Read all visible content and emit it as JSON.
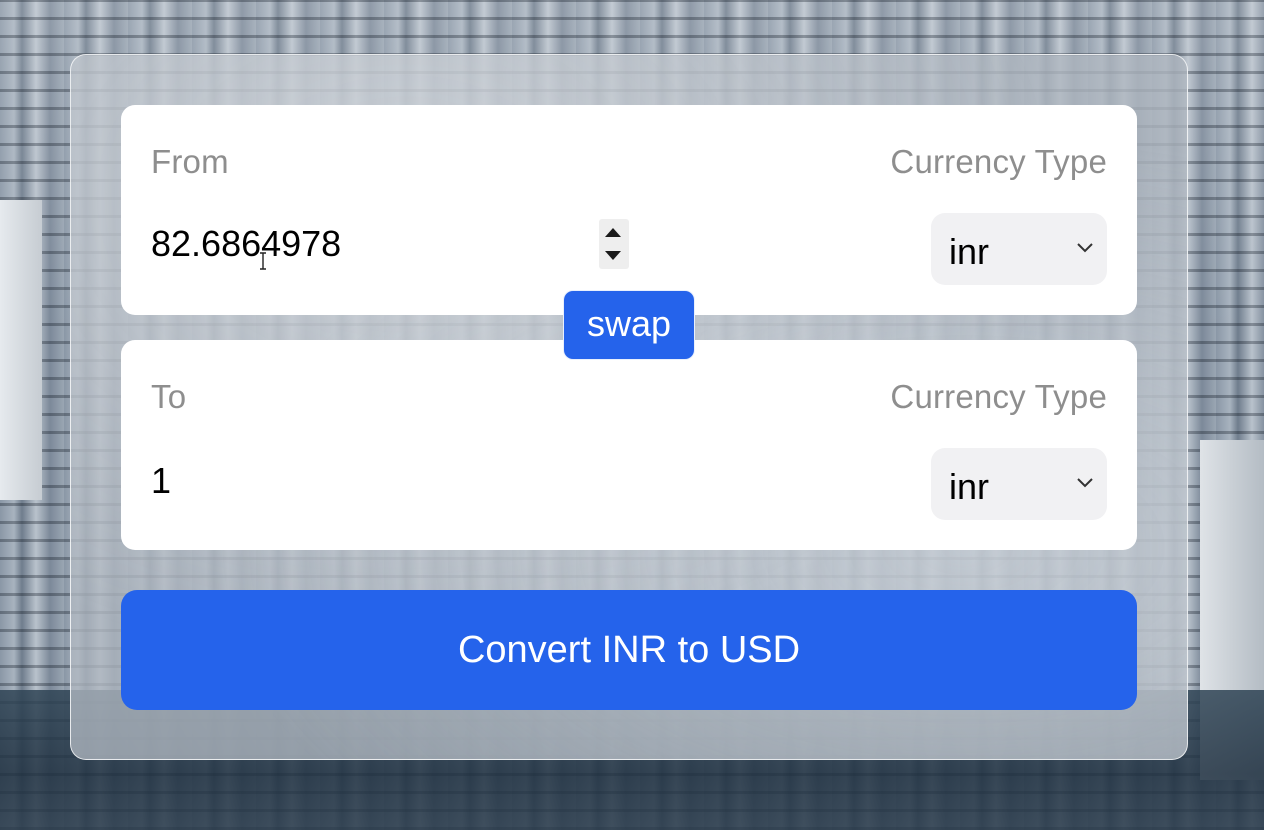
{
  "from": {
    "label": "From",
    "currency_label": "Currency Type",
    "amount": "82.6864978",
    "currency": "inr"
  },
  "to": {
    "label": "To",
    "currency_label": "Currency Type",
    "amount": "1",
    "currency": "inr"
  },
  "swap_label": "swap",
  "convert_label": "Convert INR to USD",
  "colors": {
    "accent": "#2563eb",
    "label": "#8e8e8e",
    "select_bg": "#f1f1f3"
  }
}
